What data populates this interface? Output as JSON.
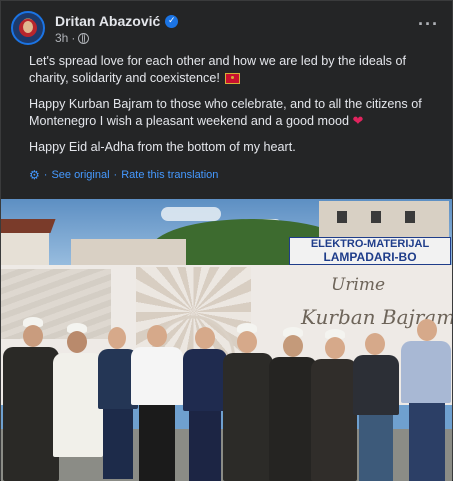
{
  "post": {
    "author": "Dritan Abazović",
    "time": "3h",
    "paragraphs": [
      "Let's spread love for each other and how we are led by the ideals of charity, solidarity and coexistence!",
      "Happy Kurban Bajram to those who celebrate, and to all the citizens of Montenegro I wish a pleasant weekend and a good mood",
      "Happy Eid al-Adha from the bottom of my heart."
    ],
    "see_original": "See original",
    "separator": "·",
    "rate_translation": "Rate this translation",
    "more_label": "···"
  },
  "photo": {
    "sign_line1": "ELEKTRO-MATERIJAL",
    "sign_line2": "LAMPADARI-BO",
    "banner_line1": "Urime",
    "banner_line2": "Kurban Bajrami"
  },
  "icons": {
    "verified": "verified-badge-icon",
    "privacy": "globe-icon",
    "translation": "gear-icon",
    "heart": "heart-icon",
    "flag": "montenegro-flag-icon"
  },
  "colors": {
    "background": "#242526",
    "text": "#e4e6eb",
    "secondary_text": "#b0b3b8",
    "link": "#4599ff",
    "verified": "#1b74e4"
  }
}
